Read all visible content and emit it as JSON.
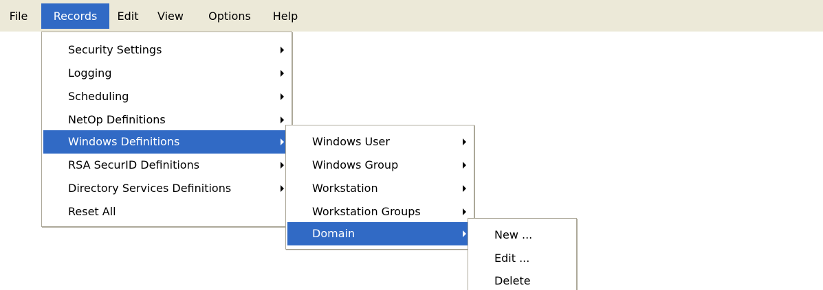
{
  "menubar": {
    "items": [
      {
        "label": "File"
      },
      {
        "label": "Records"
      },
      {
        "label": "Edit"
      },
      {
        "label": "View"
      },
      {
        "label": "Options"
      },
      {
        "label": "Help"
      }
    ]
  },
  "records_menu": {
    "items": [
      {
        "label": "Security Settings"
      },
      {
        "label": "Logging"
      },
      {
        "label": "Scheduling"
      },
      {
        "label": "NetOp Definitions"
      },
      {
        "label": "Windows Definitions"
      },
      {
        "label": "RSA SecurID Definitions"
      },
      {
        "label": "Directory Services Definitions"
      },
      {
        "label": "Reset All"
      }
    ]
  },
  "windows_definitions_menu": {
    "items": [
      {
        "label": "Windows User"
      },
      {
        "label": "Windows Group"
      },
      {
        "label": "Workstation"
      },
      {
        "label": "Workstation Groups"
      },
      {
        "label": "Domain"
      }
    ]
  },
  "domain_menu": {
    "items": [
      {
        "label": "New ..."
      },
      {
        "label": "Edit ..."
      },
      {
        "label": "Delete"
      }
    ]
  },
  "colors": {
    "menubar_bg": "#ece9d8",
    "highlight": "#316ac5",
    "menu_bg": "#ffffff",
    "menu_border": "#aca899"
  }
}
